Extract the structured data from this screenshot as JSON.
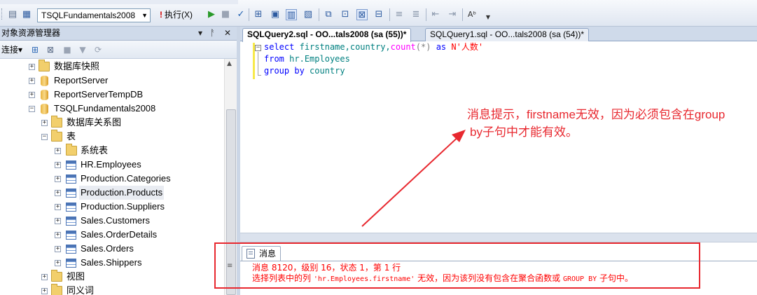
{
  "toolbar": {
    "database": "TSQLFundamentals2008",
    "execute_label": "执行(X)",
    "icons": [
      "new-query-icon",
      "play-icon",
      "stop-icon",
      "parse-check-icon",
      "plan-icon",
      "results-grid-icon",
      "comment-icon",
      "indent-icon",
      "spellcheck-icon"
    ]
  },
  "object_explorer": {
    "title": "对象资源管理器",
    "pin_glyph": "▾ 卫 ✕",
    "connect_label": "连接",
    "tree": [
      {
        "label": "数据库快照",
        "icon": "folder",
        "depth": 0
      },
      {
        "label": "ReportServer",
        "icon": "database",
        "depth": 0
      },
      {
        "label": "ReportServerTempDB",
        "icon": "database",
        "depth": 0
      },
      {
        "label": "TSQLFundamentals2008",
        "icon": "database",
        "depth": 0,
        "expanded": true
      },
      {
        "label": "数据库关系图",
        "icon": "folder",
        "depth": 1
      },
      {
        "label": "表",
        "icon": "folder",
        "depth": 1,
        "expanded": true
      },
      {
        "label": "系统表",
        "icon": "folder",
        "depth": 2
      },
      {
        "label": "HR.Employees",
        "icon": "table",
        "depth": 2
      },
      {
        "label": "Production.Categories",
        "icon": "table",
        "depth": 2
      },
      {
        "label": "Production.Products",
        "icon": "table",
        "depth": 2,
        "selected": true
      },
      {
        "label": "Production.Suppliers",
        "icon": "table",
        "depth": 2
      },
      {
        "label": "Sales.Customers",
        "icon": "table",
        "depth": 2
      },
      {
        "label": "Sales.OrderDetails",
        "icon": "table",
        "depth": 2
      },
      {
        "label": "Sales.Orders",
        "icon": "table",
        "depth": 2
      },
      {
        "label": "Sales.Shippers",
        "icon": "table",
        "depth": 2
      },
      {
        "label": "视图",
        "icon": "folder",
        "depth": 1
      },
      {
        "label": "同义词",
        "icon": "folder",
        "depth": 1
      }
    ]
  },
  "editor": {
    "tabs": [
      {
        "label": "SQLQuery2.sql - OO...tals2008 (sa (55))*",
        "active": true
      },
      {
        "label": "SQLQuery1.sql - OO...tals2008 (sa (54))*",
        "active": false
      }
    ],
    "code": {
      "l1": {
        "kw1": "select",
        "cols": "firstname,country,",
        "fn": "count",
        "args": "(*)",
        "kw2": "as",
        "alias": "N'人数'"
      },
      "l2": {
        "kw": "from",
        "table": "hr.Employees"
      },
      "l3": {
        "kw": "group by",
        "col": "country"
      }
    },
    "annotation": {
      "line1": "消息提示，firstname无效，因为必须包含在group",
      "line2": "by子句中才能有效。",
      "color": "#e8282f"
    }
  },
  "messages": {
    "tab_label": "消息",
    "line1": "消息 8120，级别 16，状态 1，第 1 行",
    "line2_a": "选择列表中的列 ",
    "line2_code": "'hr.Employees.firstname'",
    "line2_b": " 无效，因为该列没有包含在聚合函数或 ",
    "line2_code2": "GROUP BY",
    "line2_c": " 子句中。"
  }
}
